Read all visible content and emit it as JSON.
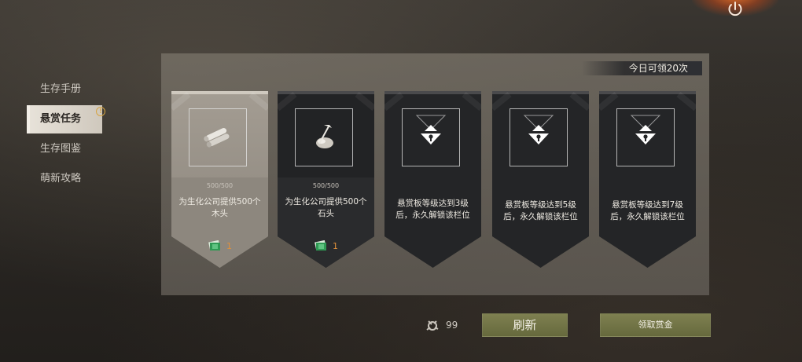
{
  "header": {
    "daily_limit": "今日可领20次"
  },
  "sidebar": {
    "items": [
      {
        "label": "生存手册"
      },
      {
        "label": "悬赏任务",
        "badge": "!"
      },
      {
        "label": "生存图鉴"
      },
      {
        "label": "萌新攻略"
      }
    ]
  },
  "cards": [
    {
      "status": "available",
      "progress": "500/500",
      "desc": "为生化公司提供500个木头",
      "reward_count": "1",
      "item_icon": "wood-logs-icon"
    },
    {
      "status": "available",
      "progress": "500/500",
      "desc": "为生化公司提供500个石头",
      "reward_count": "1",
      "item_icon": "stone-pickaxe-icon"
    },
    {
      "status": "locked",
      "desc": "悬赏板等级达到3级后，永久解锁该栏位",
      "item_icon": "lock-icon"
    },
    {
      "status": "locked",
      "desc": "悬赏板等级达到5级后，永久解锁该栏位",
      "item_icon": "lock-icon"
    },
    {
      "status": "locked",
      "desc": "悬赏板等级达到7级后，永久解锁该栏位",
      "item_icon": "lock-icon"
    }
  ],
  "footer": {
    "fuel_count": "99",
    "refresh_label": "刷新",
    "claim_label": "领取赏金"
  },
  "colors": {
    "accent_button": "#727546",
    "reward_count": "#e0903a",
    "badge": "#d7a442"
  }
}
